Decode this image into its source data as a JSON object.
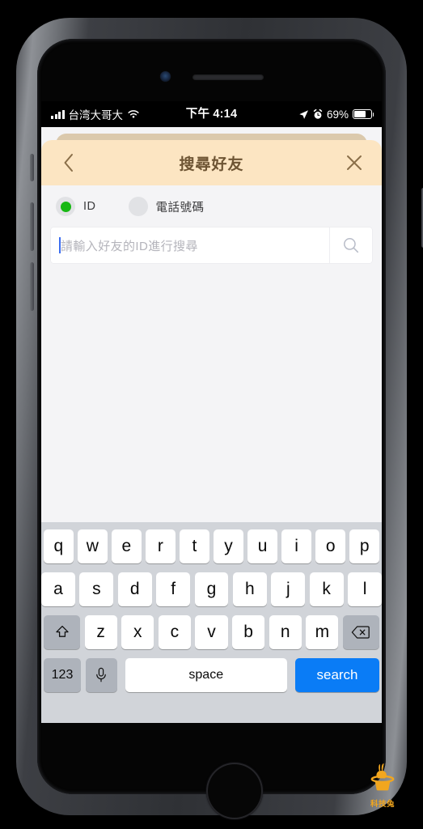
{
  "statusbar": {
    "carrier": "台湾大哥大",
    "time": "下午 4:14",
    "battery_percent": "69%",
    "signal_icon": "cellular-signal-icon",
    "wifi_icon": "wifi-icon",
    "location_icon": "location-arrow-icon",
    "alarm_icon": "alarm-clock-icon",
    "battery_icon": "battery-icon"
  },
  "modal": {
    "title": "搜尋好友",
    "back_icon": "chevron-left-icon",
    "close_icon": "close-icon",
    "header_bg": "#fce5c2",
    "header_text_color": "#6d5433",
    "back_sheet_bg": "#dbc9ac"
  },
  "search_type": {
    "options": [
      {
        "label": "ID",
        "selected": true
      },
      {
        "label": "電話號碼",
        "selected": false
      }
    ],
    "selected_color": "#17b813"
  },
  "search": {
    "value": "",
    "placeholder": "請輸入好友的ID進行搜尋",
    "search_icon": "magnifier-icon",
    "caret_color": "#3c6df0"
  },
  "keyboard": {
    "row1": [
      "q",
      "w",
      "e",
      "r",
      "t",
      "y",
      "u",
      "i",
      "o",
      "p"
    ],
    "row2": [
      "a",
      "s",
      "d",
      "f",
      "g",
      "h",
      "j",
      "k",
      "l"
    ],
    "row3": [
      "z",
      "x",
      "c",
      "v",
      "b",
      "n",
      "m"
    ],
    "shift_icon": "shift-up-arrow-icon",
    "backspace_icon": "backspace-delete-icon",
    "numeric_label": "123",
    "mic_icon": "microphone-icon",
    "space_label": "space",
    "return_label": "search",
    "return_color": "#0a7cf6"
  },
  "watermark": {
    "label": "科技兔",
    "icon": "rabbit-in-hat-logo",
    "color": "#f2a61e"
  }
}
